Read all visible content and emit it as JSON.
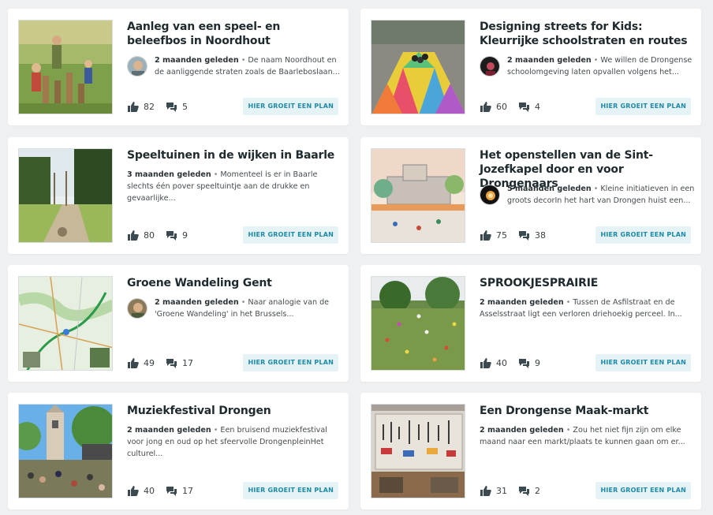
{
  "colors": {
    "accent": "#1e8aa6",
    "badge_bg": "#e6f3f6",
    "background": "#eef0f2"
  },
  "cards": [
    {
      "title": "Aanleg van een speel- en beleefbos in Noordhout",
      "time": "2 maanden geleden",
      "excerpt": "De naam Noordhout en de aanliggende straten zoals de Baarleboslaan...",
      "likes": "82",
      "comments": "5",
      "badge": "HIER GROEIT EEN PLAN",
      "thumb": "playground-forest-photo",
      "avatar": "user-avatar"
    },
    {
      "title": "Designing streets for Kids: Kleurrijke schoolstraten en routes",
      "time": "2 maanden geleden",
      "excerpt": "We willen de Drongense schoolomgeving laten opvallen volgens het...",
      "likes": "60",
      "comments": "4",
      "badge": "HIER GROEIT EEN PLAN",
      "thumb": "colorful-street-photo",
      "avatar": "user-avatar"
    },
    {
      "title": "Speeltuinen in de wijken in Baarle",
      "time": "3 maanden geleden",
      "excerpt": "Momenteel is er in Baarle slechts één pover speeltuintje aan de drukke en gevaarlijke...",
      "likes": "80",
      "comments": "9",
      "badge": "HIER GROEIT EEN PLAN",
      "thumb": "park-path-photo",
      "avatar": ""
    },
    {
      "title": "Het openstellen van de Sint-Jozefkapel door en voor Drongenaars",
      "time": "5 maanden geleden",
      "excerpt": "Kleine initiatieven in een groots decorIn het hart van Drongen huist een...",
      "likes": "75",
      "comments": "38",
      "badge": "HIER GROEIT EEN PLAN",
      "thumb": "chapel-sketch-image",
      "avatar": "user-avatar"
    },
    {
      "title": "Groene Wandeling Gent",
      "time": "2 maanden geleden",
      "excerpt": "Naar analogie van de 'Groene Wandeling' in het Brussels...",
      "likes": "49",
      "comments": "17",
      "badge": "HIER GROEIT EEN PLAN",
      "thumb": "walking-map-image",
      "avatar": "user-avatar"
    },
    {
      "title": "SPROOKJESPRAIRIE",
      "time": "2 maanden geleden",
      "excerpt": "Tussen de Asfilstraat en de Asselsstraat ligt een verloren driehoekig perceel. In...",
      "likes": "40",
      "comments": "9",
      "badge": "HIER GROEIT EEN PLAN",
      "thumb": "wildflower-meadow-photo",
      "avatar": ""
    },
    {
      "title": "Muziekfestival Drongen",
      "time": "2 maanden geleden",
      "excerpt": "Een bruisend muziekfestival voor jong en oud op het sfeervolle DrongenpleinHet culturel...",
      "likes": "40",
      "comments": "17",
      "badge": "HIER GROEIT EEN PLAN",
      "thumb": "festival-church-photo",
      "avatar": ""
    },
    {
      "title": "Een Drongense Maak-markt",
      "time": "2 maanden geleden",
      "excerpt": "Zou het niet fijn zijn om elke maand naar een markt/plaats te kunnen gaan om er...",
      "likes": "31",
      "comments": "2",
      "badge": "HIER GROEIT EEN PLAN",
      "thumb": "tool-wall-photo",
      "avatar": ""
    }
  ],
  "icons": {
    "like": "thumbs-up-icon",
    "comment": "comments-icon"
  }
}
